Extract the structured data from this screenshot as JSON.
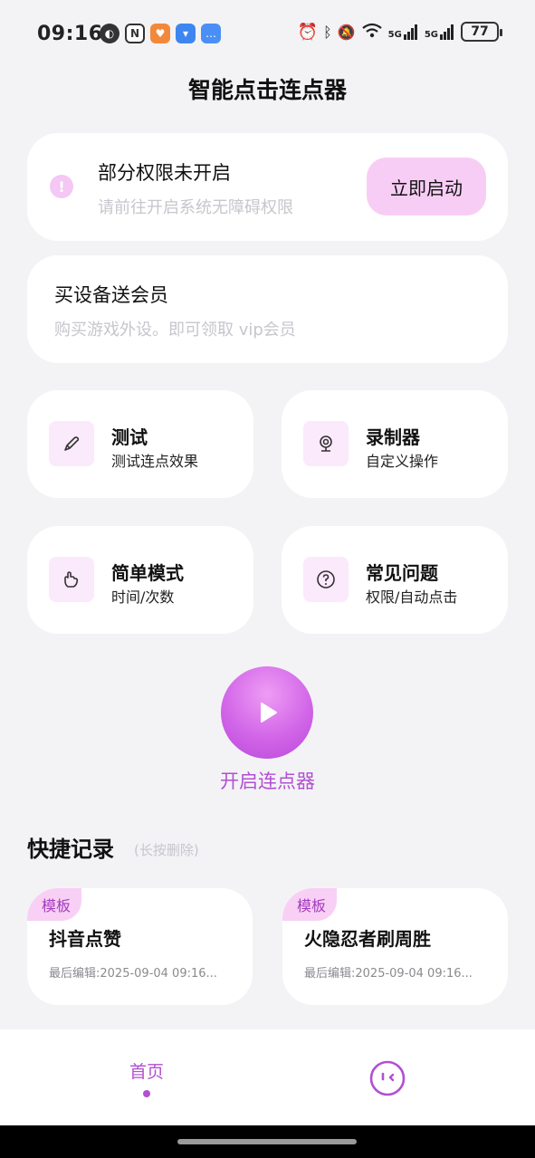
{
  "status_bar": {
    "time": "09:16",
    "network_label_1": "5G",
    "network_label_2": "5G",
    "battery": "77"
  },
  "app": {
    "title": "智能点击连点器"
  },
  "permission_card": {
    "title": "部分权限未开启",
    "subtitle": "请前往开启系统无障碍权限",
    "button_label": "立即启动",
    "icon": "alert-icon"
  },
  "vip_card": {
    "title": "买设备送会员",
    "subtitle": "购买游戏外设。即可领取 vip会员"
  },
  "features": [
    {
      "title": "测试",
      "subtitle": "测试连点效果",
      "icon": "pen-icon"
    },
    {
      "title": "录制器",
      "subtitle": "自定义操作",
      "icon": "webcam-icon"
    },
    {
      "title": "简单模式",
      "subtitle": "时间/次数",
      "icon": "hand-icon"
    },
    {
      "title": "常见问题",
      "subtitle": "权限/自动点击",
      "icon": "question-icon"
    }
  ],
  "start": {
    "label": "开启连点器",
    "icon": "play-icon"
  },
  "quick_records": {
    "title": "快捷记录",
    "hint": "(长按删除)",
    "items": [
      {
        "tag": "模板",
        "title": "抖音点赞",
        "edited": "最后编辑:2025-09-04 09:16..."
      },
      {
        "tag": "模板",
        "title": "火隐忍者刷周胜",
        "edited": "最后编辑:2025-09-04 09:16..."
      }
    ]
  },
  "tab_bar": {
    "home_label": "首页",
    "profile_icon": "face-icon"
  },
  "colors": {
    "accent": "#b24fd2",
    "accent_light": "#f8cdf5",
    "background": "#f3f3f6",
    "card": "#ffffff"
  }
}
